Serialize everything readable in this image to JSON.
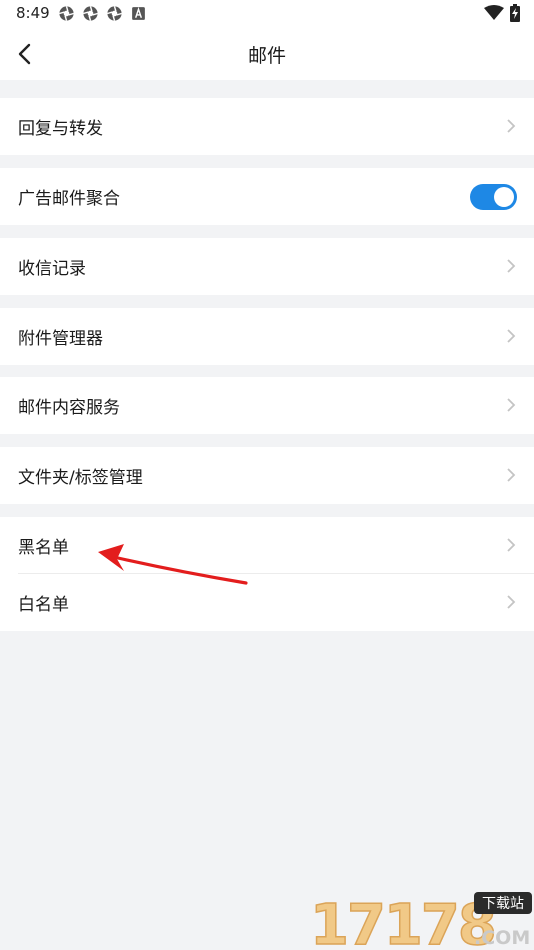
{
  "status_bar": {
    "time": "8:49",
    "notification_icons": [
      "aperture-icon",
      "aperture-icon",
      "aperture-icon",
      "text-a-icon"
    ],
    "right_icons": [
      "wifi-icon",
      "battery-charging-icon"
    ]
  },
  "header": {
    "title": "邮件",
    "back_icon": "chevron-left-icon"
  },
  "settings": [
    {
      "label": "回复与转发",
      "control": "chevron-right-icon"
    },
    {
      "label": "广告邮件聚合",
      "control": "toggle",
      "toggle_on": true
    },
    {
      "label": "收信记录",
      "control": "chevron-right-icon"
    },
    {
      "label": "附件管理器",
      "control": "chevron-right-icon"
    },
    {
      "label": "邮件内容服务",
      "control": "chevron-right-icon"
    },
    {
      "label": "文件夹/标签管理",
      "control": "chevron-right-icon"
    },
    {
      "label": "黑名单",
      "control": "chevron-right-icon"
    },
    {
      "label": "白名单",
      "control": "chevron-right-icon"
    }
  ],
  "annotation": {
    "type": "red-arrow",
    "points_to": "黑名单"
  },
  "watermark": {
    "text": "17178",
    "badge": "下载站",
    "suffix": ".COM"
  },
  "colors": {
    "accent": "#1e88e5",
    "background": "#f2f3f5",
    "surface": "#ffffff",
    "chevron": "#c4c4c4",
    "arrow": "#e31d1d"
  }
}
